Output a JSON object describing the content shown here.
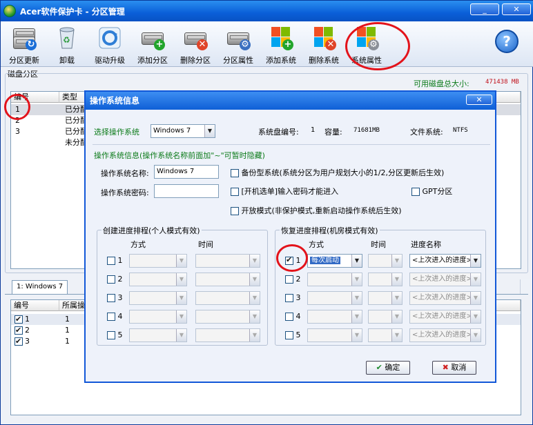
{
  "window": {
    "title": "Acer软件保护卡 - 分区管理",
    "min_label": "_",
    "close_label": "✕"
  },
  "toolbar": {
    "items": [
      {
        "label": "分区更新",
        "icon": "disk-refresh-icon"
      },
      {
        "label": "卸载",
        "icon": "recycle-bin-icon"
      },
      {
        "label": "驱动升级",
        "icon": "driver-upgrade-icon"
      },
      {
        "label": "添加分区",
        "icon": "add-partition-icon"
      },
      {
        "label": "删除分区",
        "icon": "delete-partition-icon"
      },
      {
        "label": "分区属性",
        "icon": "partition-properties-icon"
      },
      {
        "label": "添加系统",
        "icon": "add-system-icon"
      },
      {
        "label": "删除系统",
        "icon": "delete-system-icon"
      },
      {
        "label": "系统属性",
        "icon": "system-properties-icon"
      }
    ],
    "help_label": "?"
  },
  "disk": {
    "section_label": "磁盘分区",
    "capacity_label": "可用磁盘总大小:",
    "capacity_value": "471438 MB",
    "columns": [
      "编号",
      "类型"
    ],
    "rows": [
      {
        "id": "1",
        "type": "已分配"
      },
      {
        "id": "2",
        "type": "已分配"
      },
      {
        "id": "3",
        "type": "已分配"
      },
      {
        "id": "",
        "type": "未分配"
      }
    ]
  },
  "os_tab": {
    "label": "1: Windows 7"
  },
  "bottom_table": {
    "columns": [
      "编号",
      "所属操"
    ],
    "rows": [
      {
        "id": "1",
        "val": "1",
        "checked": true
      },
      {
        "id": "2",
        "val": "1",
        "checked": true
      },
      {
        "id": "3",
        "val": "1",
        "checked": true
      }
    ]
  },
  "dialog": {
    "title": "操作系统信息",
    "close_label": "✕",
    "select_os_label": "选择操作系统",
    "select_os_value": "Windows 7",
    "disk_no_label": "系统盘编号:",
    "disk_no_value": "1",
    "capacity_label": "容量:",
    "capacity_value": "71681MB",
    "fs_label": "文件系统:",
    "fs_value": "NTFS",
    "info_label": "操作系统信息(操作系统名称前面加\"~\"可暂时隐藏)",
    "name_label": "操作系统名称:",
    "name_value": "Windows 7",
    "password_label": "操作系统密码:",
    "password_value": "",
    "backup_label": "备份型系统(系统分区为用户规划大小的1/2,分区更新后生效)",
    "boot_password_label": "[开机选单]输入密码才能进入",
    "gpt_label": "GPT分区",
    "open_mode_label": "开放模式(非保护模式,重新启动操作系统后生效)",
    "create_group": {
      "title": "创建进度排程(个人模式有效)",
      "col_method": "方式",
      "col_time": "时间",
      "rows": [
        "1",
        "2",
        "3",
        "4",
        "5"
      ]
    },
    "restore_group": {
      "title": "恢复进度排程(机房模式有效)",
      "col_method": "方式",
      "col_time": "时间",
      "col_progress": "进度名称",
      "rows": [
        {
          "n": "1",
          "checked": true,
          "method": "每次启动",
          "progress": "<上次进入的进度>"
        },
        {
          "n": "2",
          "checked": false,
          "method": "",
          "progress": "<上次进入的进度>"
        },
        {
          "n": "3",
          "checked": false,
          "method": "",
          "progress": "<上次进入的进度>"
        },
        {
          "n": "4",
          "checked": false,
          "method": "",
          "progress": "<上次进入的进度>"
        },
        {
          "n": "5",
          "checked": false,
          "method": "",
          "progress": "<上次进入的进度>"
        }
      ]
    },
    "ok_label": "确定",
    "cancel_label": "取消"
  },
  "colors": {
    "accent": "#0a5fd8",
    "annotation": "#e3131b",
    "green_text": "#0a7a18",
    "capacity_red": "#c0101a"
  }
}
